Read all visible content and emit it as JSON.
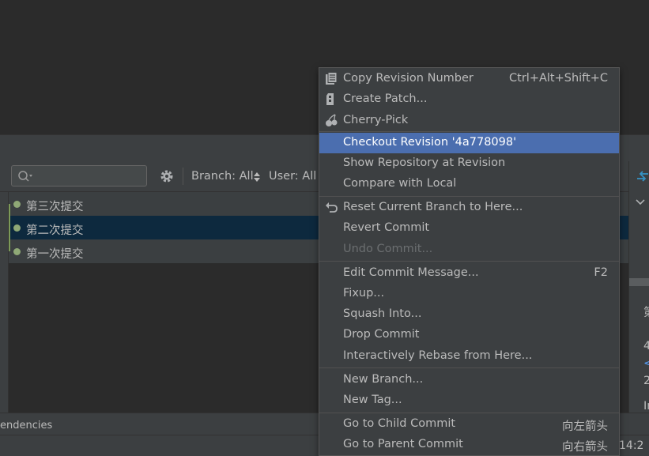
{
  "toolbar": {
    "branch_filter": "Branch: All",
    "user_filter": "User: All"
  },
  "commits": [
    {
      "message": "第三次提交"
    },
    {
      "message": "第二次提交"
    },
    {
      "message": "第一次提交"
    }
  ],
  "details": {
    "line1": "第",
    "line2": "4",
    "line3": "<",
    "line4": "2",
    "line5": "In"
  },
  "bottom": {
    "tab_label": "endencies",
    "cursor_position": "14:2"
  },
  "context_menu": {
    "items": [
      {
        "label": "Copy Revision Number",
        "shortcut": "Ctrl+Alt+Shift+C",
        "icon": "copy-icon"
      },
      {
        "label": "Create Patch...",
        "shortcut": "",
        "icon": "patch-icon"
      },
      {
        "label": "Cherry-Pick",
        "shortcut": "",
        "icon": "cherry-icon"
      },
      {
        "label": "Checkout Revision '4a778098'",
        "shortcut": "",
        "selected": true
      },
      {
        "label": "Show Repository at Revision",
        "shortcut": ""
      },
      {
        "label": "Compare with Local",
        "shortcut": ""
      },
      {
        "label": "Reset Current Branch to Here...",
        "shortcut": "",
        "icon": "undo-icon"
      },
      {
        "label": "Revert Commit",
        "shortcut": ""
      },
      {
        "label": "Undo Commit...",
        "shortcut": "",
        "disabled": true
      },
      {
        "label": "Edit Commit Message...",
        "shortcut": "F2"
      },
      {
        "label": "Fixup...",
        "shortcut": ""
      },
      {
        "label": "Squash Into...",
        "shortcut": ""
      },
      {
        "label": "Drop Commit",
        "shortcut": ""
      },
      {
        "label": "Interactively Rebase from Here...",
        "shortcut": ""
      },
      {
        "label": "New Branch...",
        "shortcut": ""
      },
      {
        "label": "New Tag...",
        "shortcut": ""
      },
      {
        "label": "Go to Child Commit",
        "shortcut": "向左箭头"
      },
      {
        "label": "Go to Parent Commit",
        "shortcut": "向右箭头"
      }
    ]
  },
  "colors": {
    "selection": "#4b6eaf",
    "selected_row": "#0d293e",
    "graph": "#7d9a58",
    "link": "#589df6"
  }
}
